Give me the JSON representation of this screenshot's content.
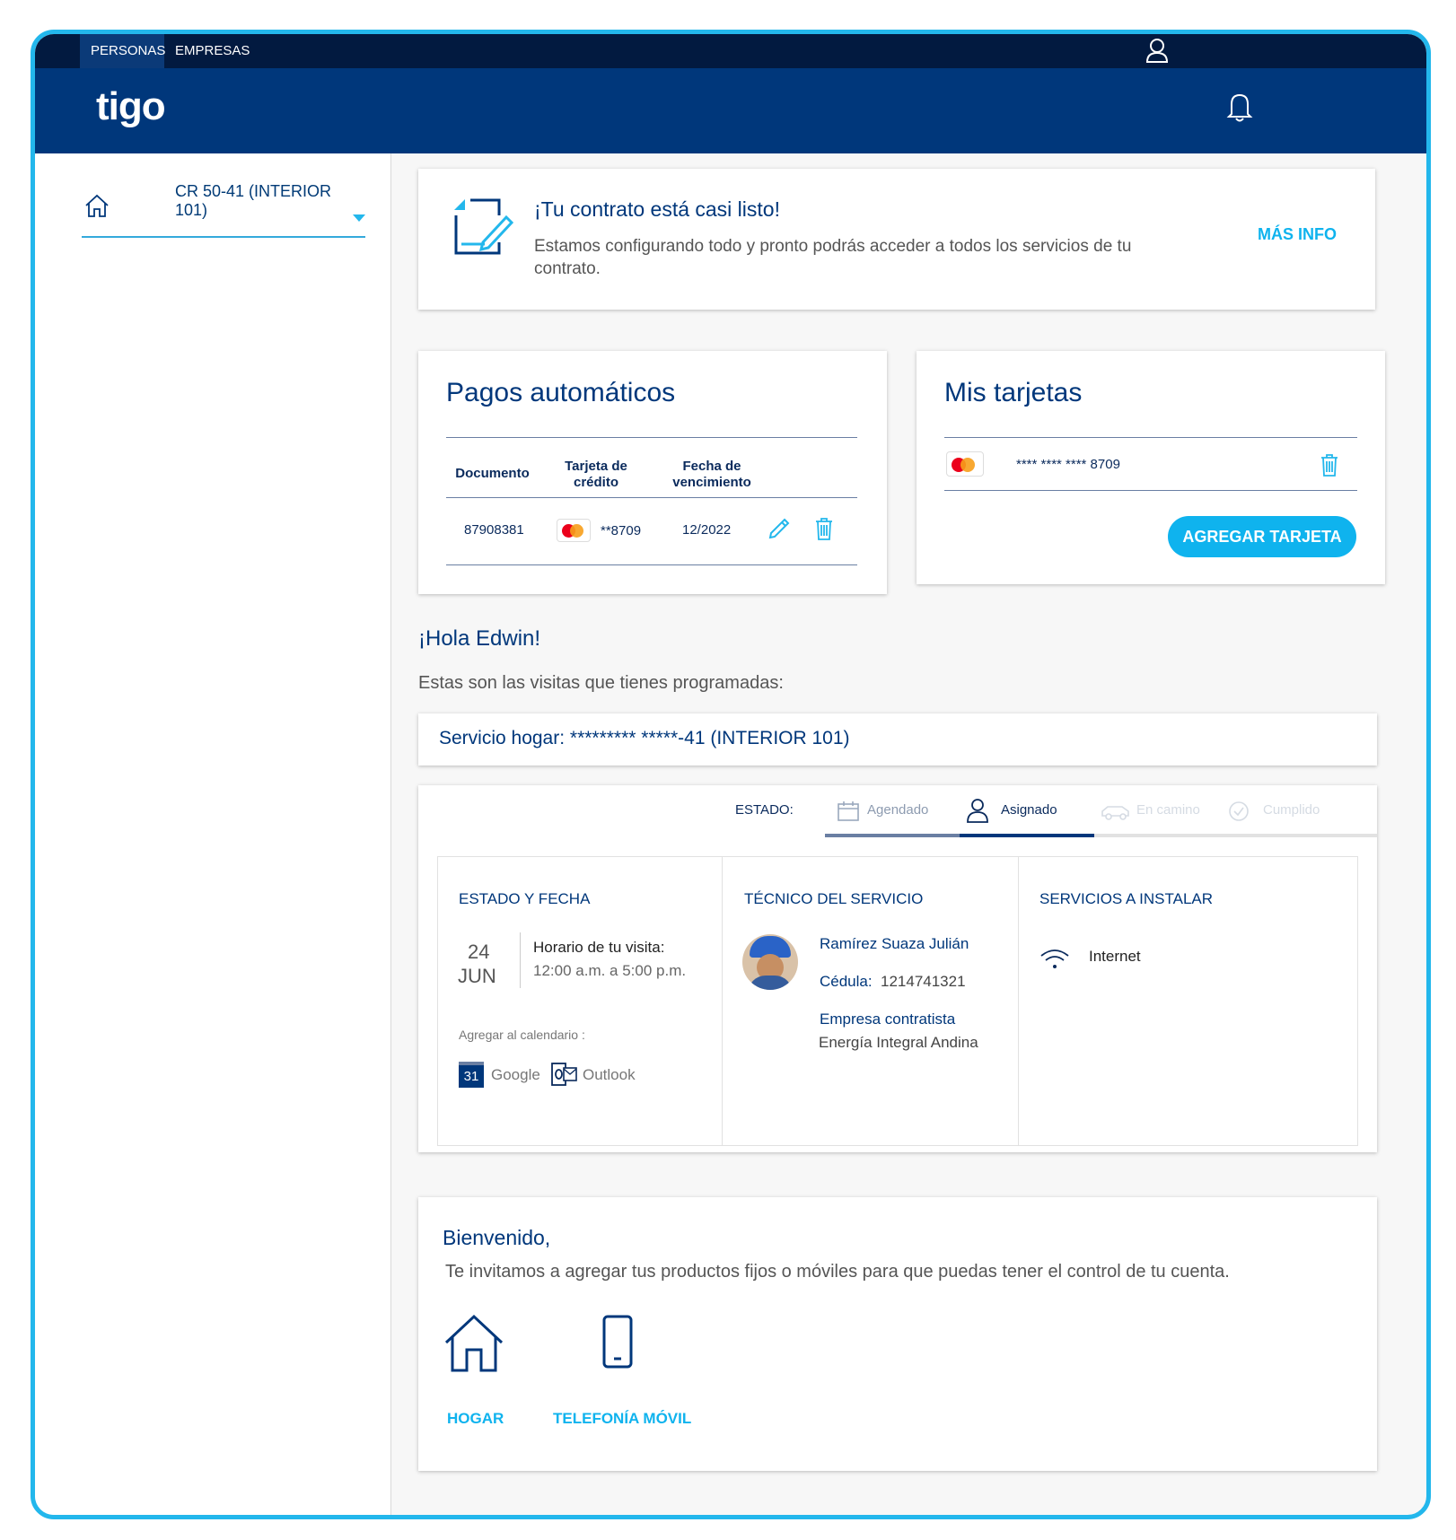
{
  "topbar": {
    "tabs": [
      {
        "label": "PERSONAS"
      },
      {
        "label": "EMPRESAS"
      }
    ]
  },
  "header": {
    "logo": "tigo"
  },
  "sidebar": {
    "address": "CR 50-41 (INTERIOR 101)"
  },
  "contract": {
    "title": "¡Tu contrato está casi listo!",
    "text": "Estamos configurando todo y pronto podrás acceder a todos los servicios de tu contrato.",
    "link": "MÁS INFO"
  },
  "autopay": {
    "title": "Pagos automáticos",
    "headers": [
      "Documento",
      "Tarjeta de crédito",
      "Fecha de vencimiento"
    ],
    "row": {
      "document": "87908381",
      "card": "**8709",
      "expiry": "12/2022"
    }
  },
  "cards": {
    "title": "Mis tarjetas",
    "card_number": "**** **** **** 8709",
    "add_button": "AGREGAR TARJETA"
  },
  "greeting": {
    "hello": "¡Hola Edwin!",
    "subtitle": "Estas son las visitas que tienes programadas:"
  },
  "service": {
    "label": "Servicio hogar: ********* *****-41 (INTERIOR 101)"
  },
  "status": {
    "label": "ESTADO:",
    "steps": [
      {
        "label": "Agendado",
        "state": "done"
      },
      {
        "label": "Asignado",
        "state": "active"
      },
      {
        "label": "En camino",
        "state": "pending"
      },
      {
        "label": "Cumplido",
        "state": "pending"
      }
    ]
  },
  "visit": {
    "date_title": "ESTADO Y FECHA",
    "day": "24",
    "month": "JUN",
    "schedule_label": "Horario de tu visita:",
    "schedule_value": "12:00 a.m. a 5:00 p.m.",
    "calendar_label": "Agregar al calendario :",
    "google_day": "31",
    "google": "Google",
    "outlook": "Outlook",
    "tech_title": "TÉCNICO DEL SERVICIO",
    "tech_name": "Ramírez Suaza Julián",
    "id_label": "Cédula:",
    "id_value": "1214741321",
    "company_label": "Empresa contratista",
    "company_value": "Energía Integral Andina",
    "services_title": "SERVICIOS A INSTALAR",
    "service_item": "Internet"
  },
  "welcome": {
    "title": "Bienvenido,",
    "text": "Te invitamos a agregar tus productos fijos o móviles para que puedas tener el control de tu cuenta.",
    "home": "HOGAR",
    "mobile": "TELEFONÍA MÓVIL"
  },
  "colors": {
    "navy": "#00377b",
    "cyan": "#0fb3ee",
    "topbar": "#021a40"
  }
}
